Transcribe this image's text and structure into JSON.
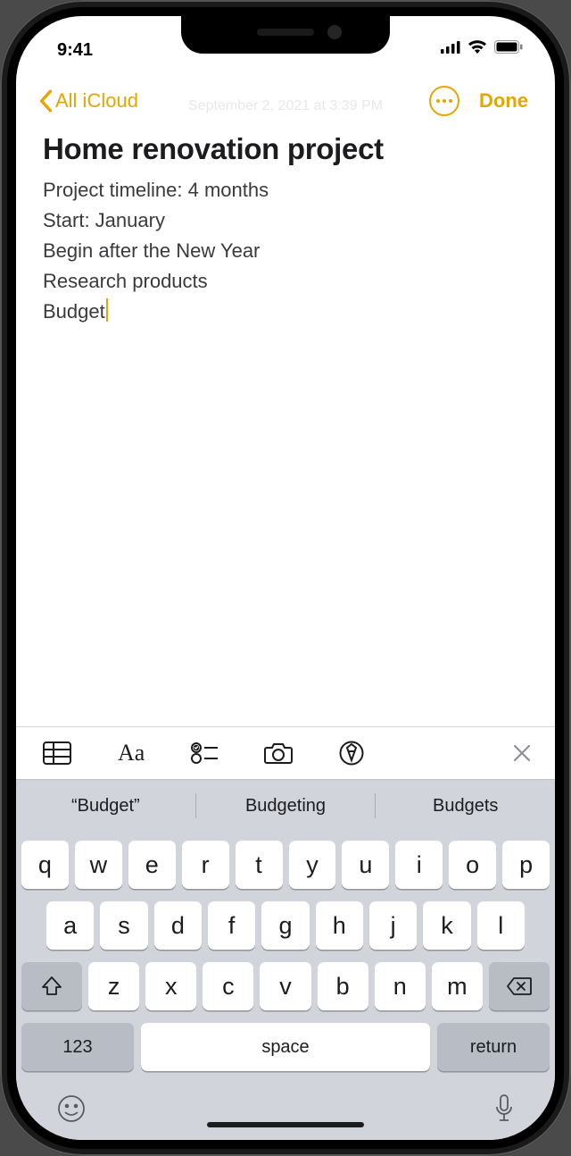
{
  "status": {
    "time": "9:41"
  },
  "nav": {
    "back_label": "All iCloud",
    "done_label": "Done",
    "date": "September 2, 2021 at 3:39 PM"
  },
  "note": {
    "title": "Home renovation project",
    "lines": [
      "Project timeline: 4 months",
      "Start: January",
      "Begin after the New Year",
      "Research products",
      "Budget"
    ]
  },
  "keyboard": {
    "suggestions": [
      "“Budget”",
      "Budgeting",
      "Budgets"
    ],
    "row1": [
      "q",
      "w",
      "e",
      "r",
      "t",
      "y",
      "u",
      "i",
      "o",
      "p"
    ],
    "row2": [
      "a",
      "s",
      "d",
      "f",
      "g",
      "h",
      "j",
      "k",
      "l"
    ],
    "row3": [
      "z",
      "x",
      "c",
      "v",
      "b",
      "n",
      "m"
    ],
    "numbers_label": "123",
    "space_label": "space",
    "return_label": "return"
  },
  "colors": {
    "accent": "#e6a500"
  }
}
